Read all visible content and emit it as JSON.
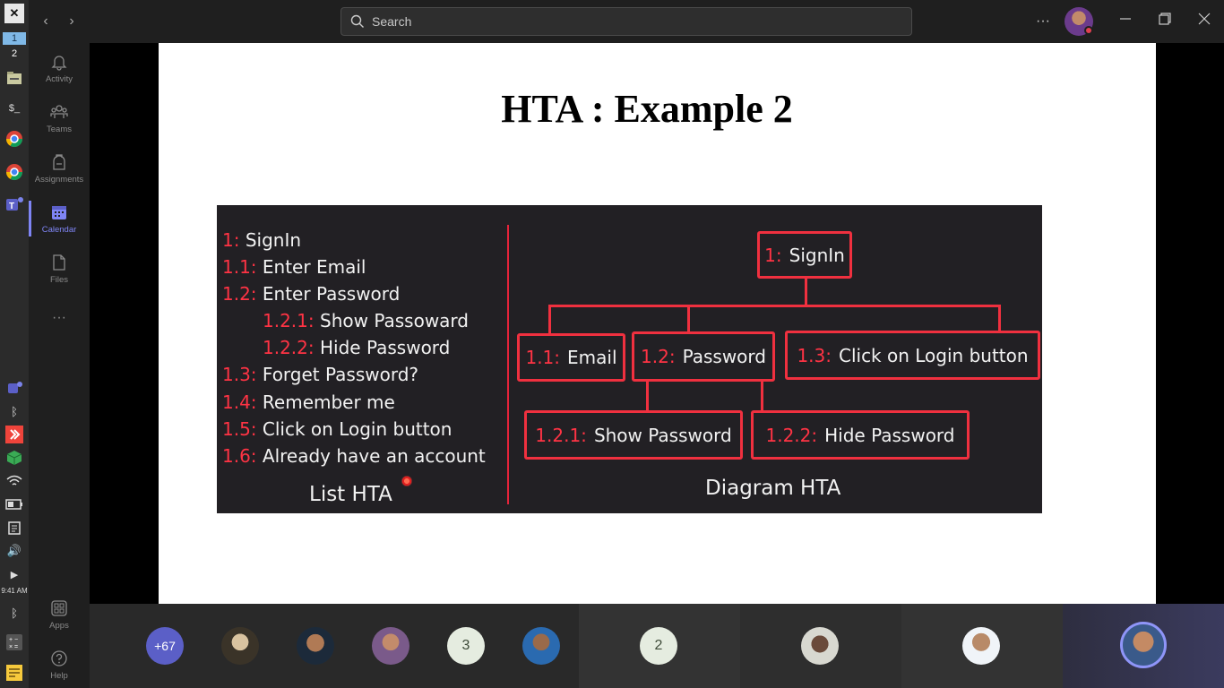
{
  "os_taskbar": {
    "workspaces": [
      "1",
      "2"
    ],
    "clock": "9:41 AM"
  },
  "app_rail": {
    "items": [
      {
        "label": "Activity",
        "icon": "bell-icon"
      },
      {
        "label": "Teams",
        "icon": "teams-icon"
      },
      {
        "label": "Assignments",
        "icon": "backpack-icon"
      },
      {
        "label": "Calendar",
        "icon": "calendar-icon",
        "active": true
      },
      {
        "label": "Files",
        "icon": "file-icon"
      },
      {
        "label": "Apps",
        "icon": "apps-grid-icon"
      },
      {
        "label": "Help",
        "icon": "help-icon"
      }
    ],
    "more": "···"
  },
  "topbar": {
    "search_placeholder": "Search",
    "more": "···"
  },
  "slide": {
    "title": "HTA : Example 2",
    "list": [
      {
        "num": "1:",
        "text": "SignIn",
        "indent": 0
      },
      {
        "num": "1.1:",
        "text": "Enter Email",
        "indent": 0
      },
      {
        "num": "1.2:",
        "text": "Enter Password",
        "indent": 0
      },
      {
        "num": "1.2.1:",
        "text": "Show Passoward",
        "indent": 1
      },
      {
        "num": "1.2.2:",
        "text": "Hide Password",
        "indent": 1
      },
      {
        "num": "1.3:",
        "text": "Forget Password?",
        "indent": 0
      },
      {
        "num": "1.4:",
        "text": "Remember me",
        "indent": 0
      },
      {
        "num": "1.5:",
        "text": "Click on Login button",
        "indent": 0
      },
      {
        "num": "1.6:",
        "text": "Already have an account",
        "indent": 0
      }
    ],
    "list_caption": "List HTA",
    "diagram_caption": "Diagram HTA",
    "nodes": {
      "root": {
        "num": "1:",
        "text": "SignIn"
      },
      "email": {
        "num": "1.1:",
        "text": "Email"
      },
      "password": {
        "num": "1.2:",
        "text": "Password"
      },
      "login": {
        "num": "1.3:",
        "text": "Click on Login button"
      },
      "show": {
        "num": "1.2.1:",
        "text": "Show Password"
      },
      "hide": {
        "num": "1.2.2:",
        "text": "Hide Password"
      }
    }
  },
  "participants": {
    "overflow": "+67",
    "counts": [
      "3",
      "2"
    ]
  }
}
